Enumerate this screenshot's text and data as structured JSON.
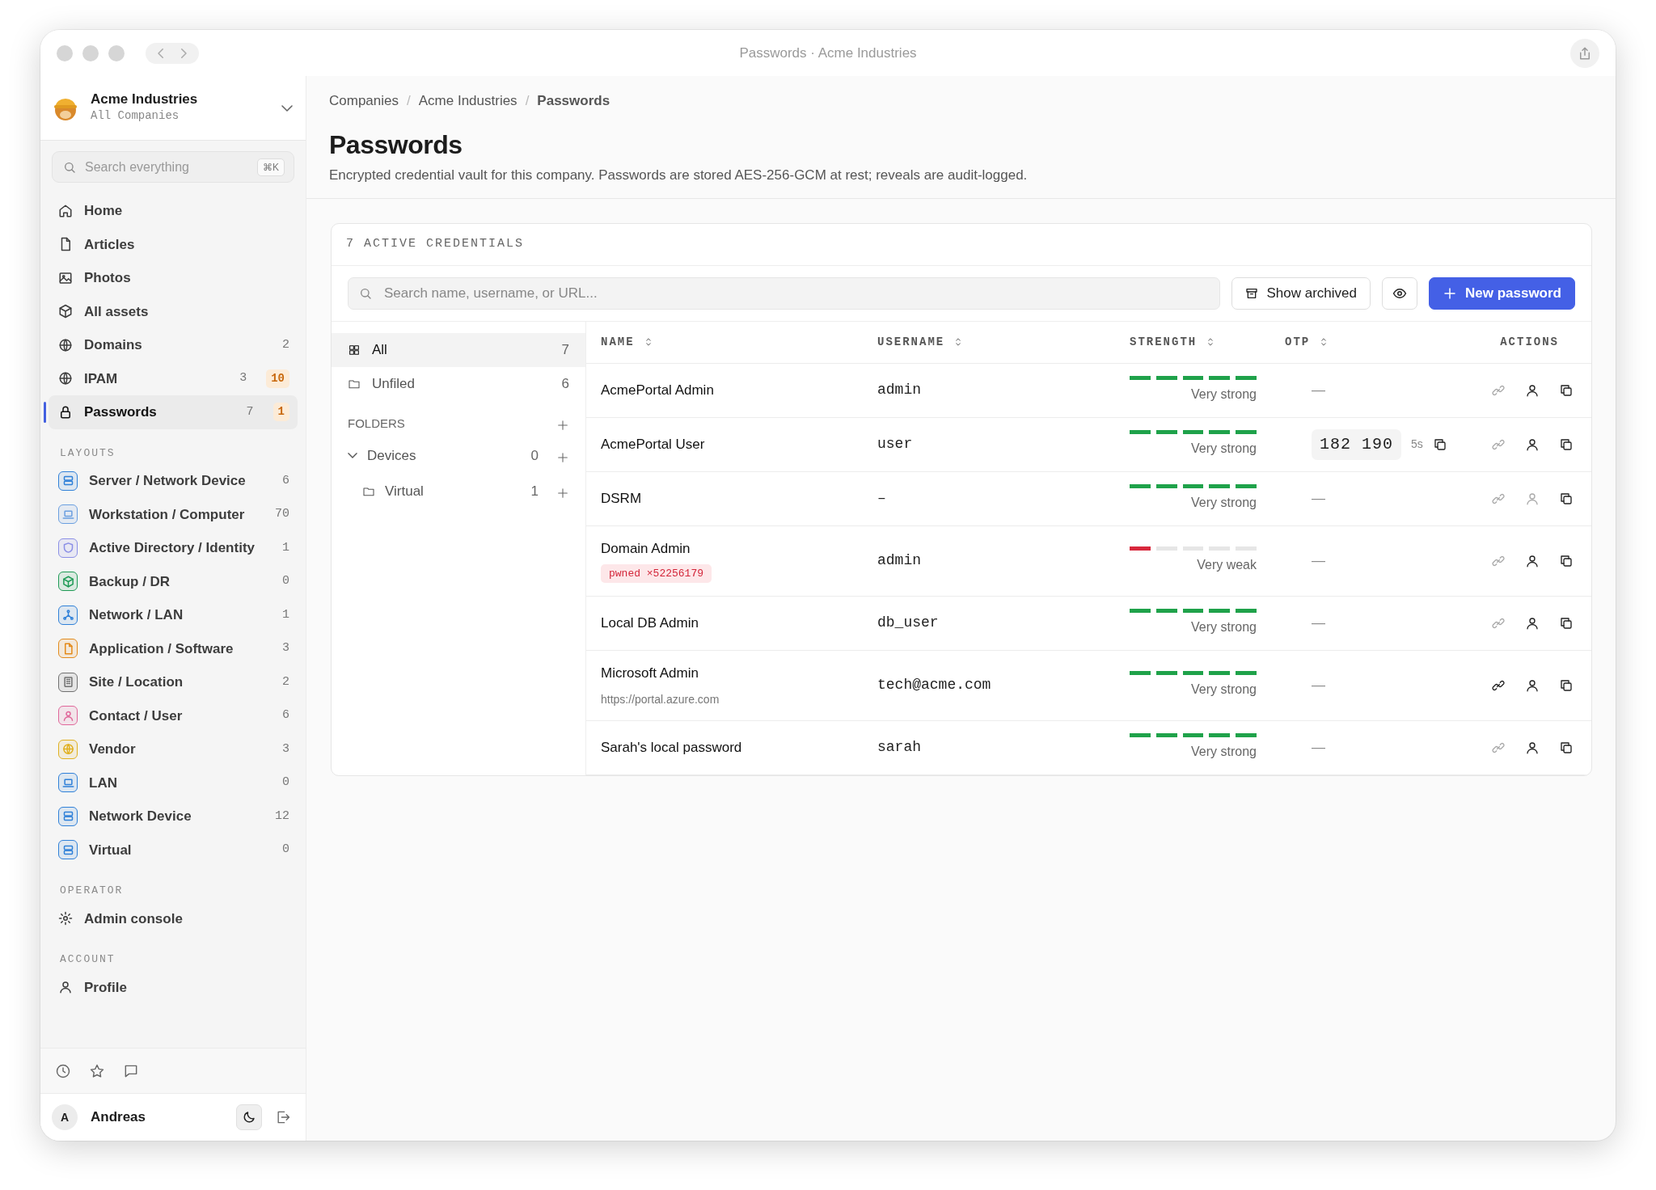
{
  "window": {
    "title": "Passwords · Acme Industries"
  },
  "sidebar": {
    "company": {
      "name": "Acme Industries",
      "subtitle": "All Companies"
    },
    "search": {
      "placeholder": "Search everything",
      "shortcut": "⌘K"
    },
    "nav": [
      {
        "label": "Home",
        "selected": false
      },
      {
        "label": "Articles",
        "selected": false
      },
      {
        "label": "Photos",
        "selected": false
      },
      {
        "label": "All assets",
        "selected": false
      },
      {
        "label": "Domains",
        "count": "2",
        "selected": false
      },
      {
        "label": "IPAM",
        "count": "3",
        "alert": "10",
        "selected": false
      },
      {
        "label": "Passwords",
        "count": "7",
        "alert": "1",
        "selected": true
      }
    ],
    "layouts_title": "LAYOUTS",
    "layouts": [
      {
        "label": "Server / Network Device",
        "count": "6",
        "color": "#2f80d8"
      },
      {
        "label": "Workstation / Computer",
        "count": "70",
        "color": "#6a9fe0"
      },
      {
        "label": "Active Directory / Identity",
        "count": "1",
        "color": "#8b8fe6"
      },
      {
        "label": "Backup / DR",
        "count": "0",
        "color": "#1e9a55"
      },
      {
        "label": "Network / LAN",
        "count": "1",
        "color": "#2f80d8"
      },
      {
        "label": "Application / Software",
        "count": "3",
        "color": "#e38a1a"
      },
      {
        "label": "Site / Location",
        "count": "2",
        "color": "#707070"
      },
      {
        "label": "Contact / User",
        "count": "6",
        "color": "#e0679a"
      },
      {
        "label": "Vendor",
        "count": "3",
        "color": "#e0b020"
      },
      {
        "label": "LAN",
        "count": "0",
        "color": "#2f80d8"
      },
      {
        "label": "Network Device",
        "count": "12",
        "color": "#2f80d8"
      },
      {
        "label": "Virtual",
        "count": "0",
        "color": "#2f80d8"
      }
    ],
    "operator_title": "OPERATOR",
    "operator": [
      {
        "label": "Admin console"
      }
    ],
    "account_title": "ACCOUNT",
    "account": [
      {
        "label": "Profile"
      }
    ],
    "user": {
      "initial": "A",
      "name": "Andreas"
    }
  },
  "breadcrumb_separator": "/",
  "breadcrumb": [
    {
      "label": "Companies",
      "current": false
    },
    {
      "label": "Acme Industries",
      "current": false
    },
    {
      "label": "Passwords",
      "current": true
    }
  ],
  "page": {
    "title": "Passwords",
    "description": "Encrypted credential vault for this company. Passwords are stored AES-256-GCM at rest; reveals are audit-logged."
  },
  "card": {
    "heading": "7 ACTIVE CREDENTIALS",
    "search": {
      "placeholder": "Search name, username, or URL..."
    },
    "show_archived": "Show archived",
    "new_password": "New password"
  },
  "folders": {
    "items": [
      {
        "label": "All",
        "count": "7",
        "selected": true
      },
      {
        "label": "Unfiled",
        "count": "6",
        "selected": false
      }
    ],
    "title": "FOLDERS",
    "tree": [
      {
        "label": "Devices",
        "count": "0",
        "expanded": true,
        "children": [
          {
            "label": "Virtual",
            "count": "1"
          }
        ]
      }
    ]
  },
  "table": {
    "columns": [
      {
        "label": "NAME",
        "sortable": true
      },
      {
        "label": "USERNAME",
        "sortable": true
      },
      {
        "label": "STRENGTH",
        "sortable": true
      },
      {
        "label": "OTP",
        "sortable": true
      },
      {
        "label": "ACTIONS",
        "sortable": false
      }
    ],
    "rows": [
      {
        "name": "AcmePortal Admin",
        "username": "admin",
        "level": 1,
        "strength": "Very strong",
        "otp": {
          "kind": "none",
          "text": "—"
        },
        "actions": [
          {
            "kind": "link",
            "disabled": true
          },
          {
            "kind": "user",
            "disabled": false
          },
          {
            "kind": "copy",
            "disabled": false
          }
        ]
      },
      {
        "name": "AcmePortal User",
        "username": "user",
        "level": 1,
        "strength": "Very strong",
        "otp": {
          "kind": "code",
          "code": "182 190",
          "timer": "5s"
        },
        "actions": [
          {
            "kind": "link",
            "disabled": true
          },
          {
            "kind": "user",
            "disabled": false
          },
          {
            "kind": "copy",
            "disabled": false
          }
        ]
      },
      {
        "name": "DSRM",
        "username": "–",
        "level": 1,
        "strength": "Very strong",
        "otp": {
          "kind": "none",
          "text": "—"
        },
        "actions": [
          {
            "kind": "link",
            "disabled": true
          },
          {
            "kind": "user",
            "disabled": true
          },
          {
            "kind": "copy",
            "disabled": false
          }
        ]
      },
      {
        "name": "Domain Admin",
        "pwned": "pwned ×52256179",
        "username": "admin",
        "level": 0.2,
        "strength": "Very weak",
        "otp": {
          "kind": "none",
          "text": "—"
        },
        "actions": [
          {
            "kind": "link",
            "disabled": true
          },
          {
            "kind": "user",
            "disabled": false
          },
          {
            "kind": "copy",
            "disabled": false
          }
        ]
      },
      {
        "name": "Local DB Admin",
        "username": "db_user",
        "level": 1,
        "strength": "Very strong",
        "otp": {
          "kind": "none",
          "text": "—"
        },
        "actions": [
          {
            "kind": "link",
            "disabled": true
          },
          {
            "kind": "user",
            "disabled": false
          },
          {
            "kind": "copy",
            "disabled": false
          }
        ]
      },
      {
        "name": "Microsoft Admin",
        "url": "https://portal.azure.com",
        "username": "tech@acme.com",
        "level": 1,
        "strength": "Very strong",
        "otp": {
          "kind": "none",
          "text": "—"
        },
        "actions": [
          {
            "kind": "link",
            "disabled": false
          },
          {
            "kind": "user",
            "disabled": false
          },
          {
            "kind": "copy",
            "disabled": false
          }
        ]
      },
      {
        "name": "Sarah's local password",
        "username": "sarah",
        "level": 1,
        "strength": "Very strong",
        "otp": {
          "kind": "none",
          "text": "—"
        },
        "actions": [
          {
            "kind": "link",
            "disabled": true
          },
          {
            "kind": "user",
            "disabled": false
          },
          {
            "kind": "copy",
            "disabled": false
          }
        ]
      }
    ]
  }
}
